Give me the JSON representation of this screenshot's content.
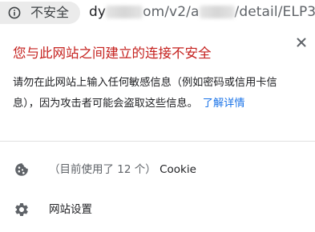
{
  "address_bar": {
    "security_label": "不安全",
    "url_part_1": "dy",
    "url_part_2": "om/v2/",
    "url_part_3": "a",
    "url_part_4": "/detail/ELP3"
  },
  "popup": {
    "title": "您与此网站之间建立的连接不安全",
    "description": "请勿在此网站上输入任何敏感信息（例如密码或信用卡信息），因为攻击者可能会盗取这些信息。",
    "learn_more": "了解详情",
    "cookie_count_text": "（目前使用了 12 个）",
    "cookie_label": "Cookie",
    "site_settings_label": "网站设置"
  },
  "colors": {
    "warning_red": "#c5221f",
    "link_blue": "#1a73e8",
    "chip_bg": "#ebebeb"
  }
}
